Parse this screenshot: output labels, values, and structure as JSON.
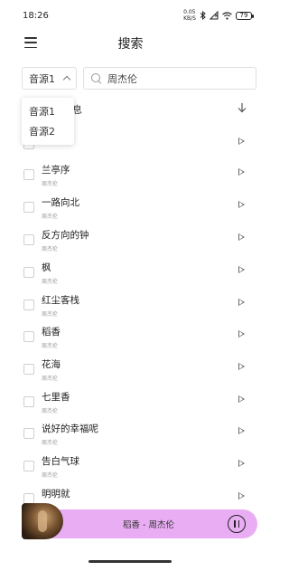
{
  "status_bar": {
    "time": "18:26",
    "net_speed_value": "0.05",
    "net_speed_unit": "KB/S",
    "battery": "79"
  },
  "header": {
    "title": "搜索"
  },
  "search": {
    "source_selected": "音源1",
    "query": "周杰伦",
    "source_options": [
      "音源1",
      "音源2"
    ]
  },
  "list_header": {
    "label": "息"
  },
  "songs": [
    {
      "title": "",
      "artist": ""
    },
    {
      "title": "兰亭序",
      "artist": "周杰伦"
    },
    {
      "title": "一路向北",
      "artist": "周杰伦"
    },
    {
      "title": "反方向的钟",
      "artist": "周杰伦"
    },
    {
      "title": "枫",
      "artist": "周杰伦"
    },
    {
      "title": "红尘客栈",
      "artist": "周杰伦"
    },
    {
      "title": "稻香",
      "artist": "周杰伦"
    },
    {
      "title": "花海",
      "artist": "周杰伦"
    },
    {
      "title": "七里香",
      "artist": "周杰伦"
    },
    {
      "title": "说好的幸福呢",
      "artist": "周杰伦"
    },
    {
      "title": "告白气球",
      "artist": "周杰伦"
    },
    {
      "title": "明明就",
      "artist": ""
    }
  ],
  "player": {
    "now_playing": "稻香 - 周杰伦",
    "accent": "#e9adf3"
  },
  "icons": {
    "menu": "hamburger-icon",
    "search": "search-icon",
    "download": "download-icon",
    "play": "play-icon",
    "pause": "pause-icon"
  }
}
